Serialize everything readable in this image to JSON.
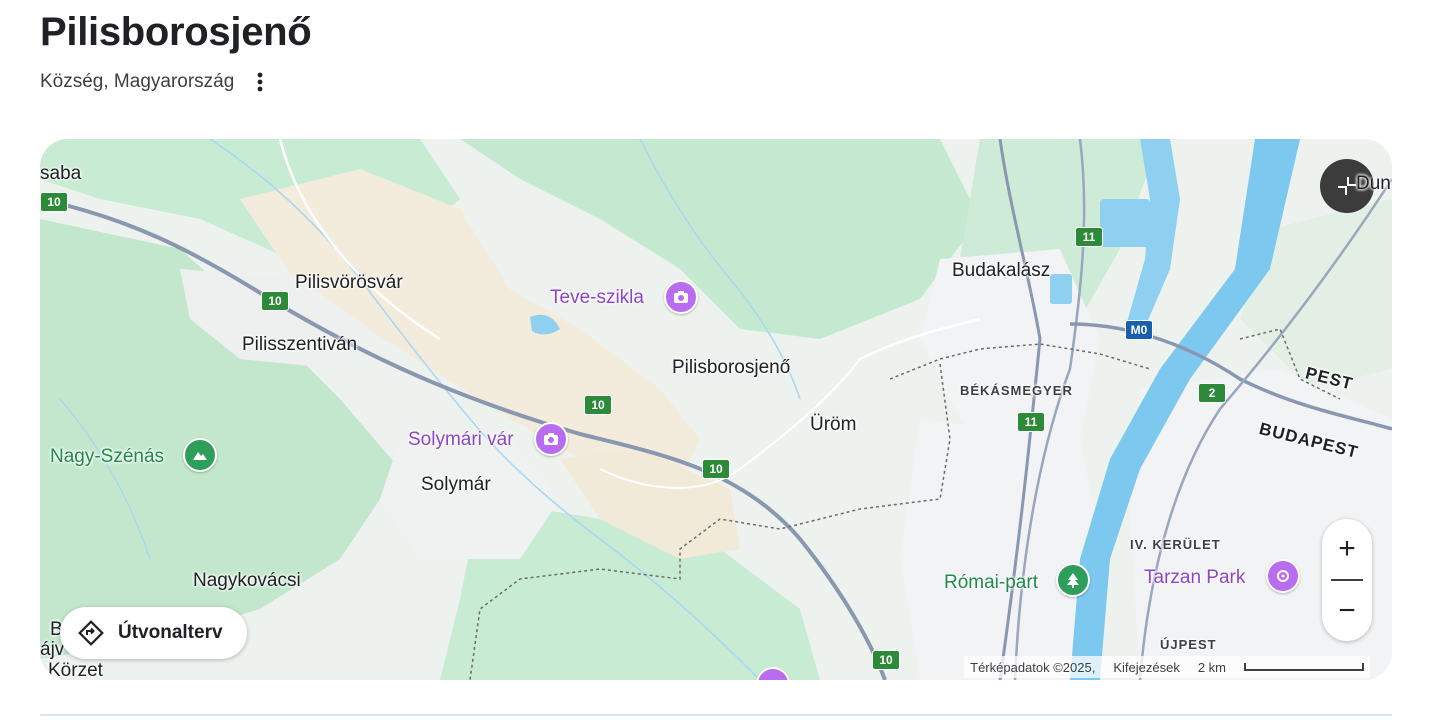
{
  "place": {
    "title": "Pilisborosjenő",
    "subtitle": "Község, Magyarország"
  },
  "map": {
    "route_button_label": "Útvonalterv",
    "zoom_in": "+",
    "zoom_out": "−",
    "attribution": "Térképadatok ©2025,",
    "terms": "Kifejezések",
    "scale_label": "2 km",
    "labels": {
      "saba": "saba",
      "dun": "Dun",
      "pilisvorosvar": "Pilisvörösvár",
      "pilisszentivan": "Pilisszentiván",
      "pilisborosjeno": "Pilisborosjenő",
      "budakalasz": "Budakalász",
      "bekasmegyer": "BÉKÁSMEGYER",
      "pest": "PEST",
      "budapest": "BUDAPEST",
      "urom": "Üröm",
      "solymar": "Solymár",
      "nagykovacsi": "Nagykovácsi",
      "iv_kerulet": "IV. KERÜLET",
      "ujpest": "ÚJPEST",
      "korzet": "Körzet",
      "edge_b": "B",
      "edge_taj": "ájv"
    },
    "pois": {
      "teve_szikla": "Teve-szikla",
      "solymari_var": "Solymári vár",
      "nagy_szenas": "Nagy-Szénás",
      "romai_part": "Római-part",
      "tarzan_park": "Tarzan Park"
    },
    "road_shields": [
      "10",
      "10",
      "10",
      "10",
      "11",
      "11",
      "M0",
      "2",
      "10"
    ],
    "colors": {
      "forest": "#c8ebd4",
      "urban": "#f1f3f4",
      "sand": "#f5eede",
      "water": "#7cc8ee",
      "road": "#8a97b0",
      "poi_purple": "#b96cf0",
      "poi_green": "#2e9e5b",
      "shield_green": "#2c8a39",
      "shield_blue": "#1a5fae"
    }
  }
}
